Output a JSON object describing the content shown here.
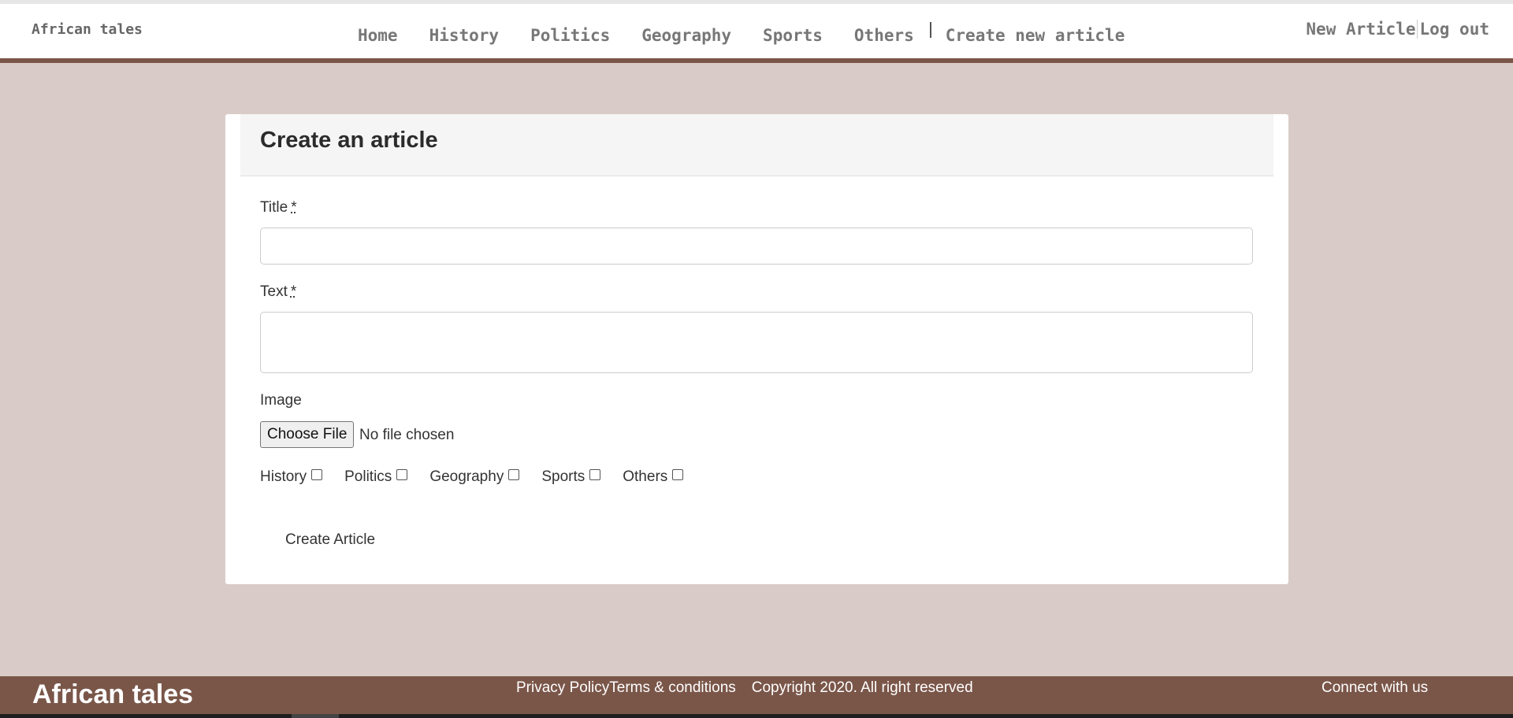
{
  "header": {
    "brand": "African tales",
    "nav": [
      "Home",
      "History",
      "Politics",
      "Geography",
      "Sports",
      "Others"
    ],
    "create_link": "Create new article",
    "new_article": "New Article",
    "logout": "Log out"
  },
  "form": {
    "heading": "Create an article",
    "title_label": "Title",
    "text_label": "Text",
    "required_mark": "*",
    "title_value": "",
    "text_value": "",
    "image_label": "Image",
    "file_button": "Choose File",
    "file_status": "No file chosen",
    "categories": [
      {
        "label": "History",
        "checked": false
      },
      {
        "label": "Politics",
        "checked": false
      },
      {
        "label": "Geography",
        "checked": false
      },
      {
        "label": "Sports",
        "checked": false
      },
      {
        "label": "Others",
        "checked": false
      }
    ],
    "submit": "Create Article"
  },
  "footer": {
    "brand": "African tales",
    "privacy": "Privacy Policy",
    "terms": "Terms & conditions",
    "copyright": "Copyright 2020. All right reserved",
    "connect": "Connect with us"
  },
  "colors": {
    "page_background": "#d9ccc8",
    "accent_brown": "#7a5649",
    "card_background": "#ffffff"
  }
}
